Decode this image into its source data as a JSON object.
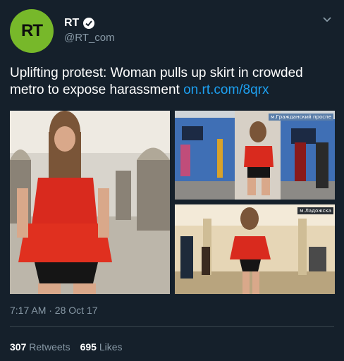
{
  "author": {
    "avatar_text": "RT",
    "display_name": "RT",
    "handle": "@RT_com",
    "verified_icon": "verified-badge-icon"
  },
  "tweet": {
    "text": "Uplifting protest: Woman pulls up skirt in crowded metro to expose harassment",
    "link": "on.rt.com/8qrx",
    "timestamp": "7:17 AM · 28 Oct 17"
  },
  "media": {
    "photo_tr_sign": "м.Гражданский проспе",
    "photo_br_sign": "м.Ладожска"
  },
  "stats": {
    "retweets_count": "307",
    "retweets_label": "Retweets",
    "likes_count": "695",
    "likes_label": "Likes"
  },
  "colors": {
    "background": "#15202b",
    "link": "#1da1f2",
    "secondary_text": "#8899a6",
    "rt_brand": "#77b82a"
  }
}
